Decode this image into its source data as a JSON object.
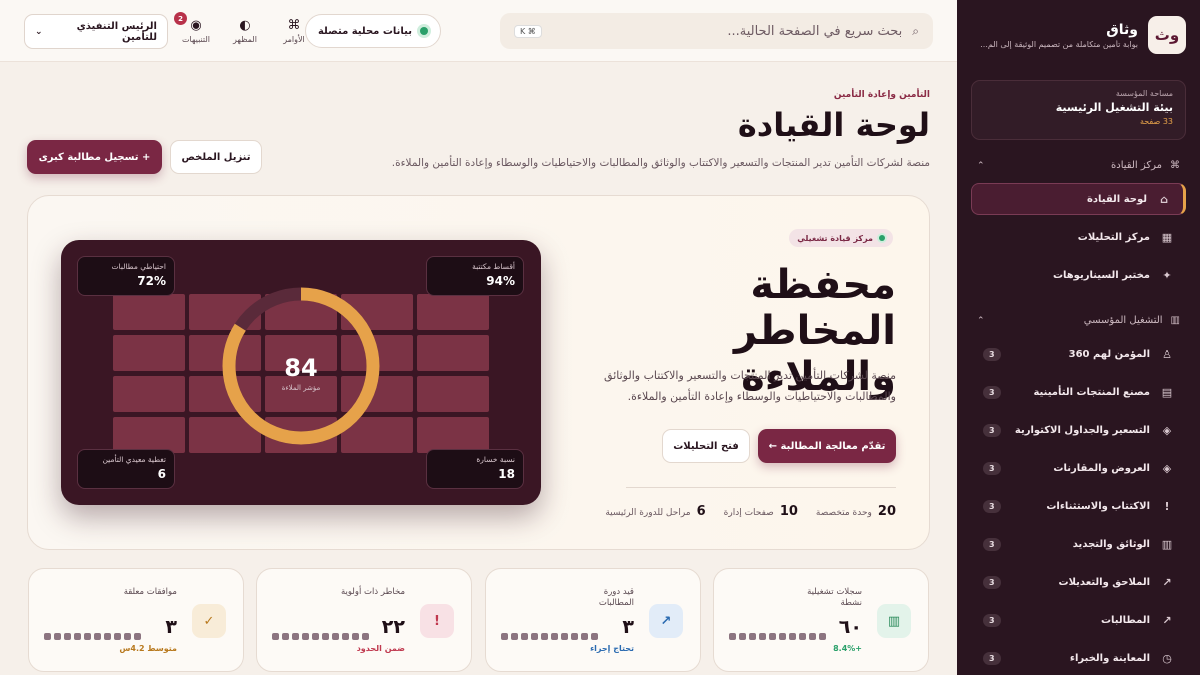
{
  "brand": {
    "logo": "وث",
    "name": "وثاق",
    "subtitle": "بوابة تأمين متكاملة من تصميم الوثيقة إلى الم..."
  },
  "workspace": {
    "label": "مساحة المؤسسة",
    "name": "بيئة التشغيل الرئيسية",
    "count": "33 صفحة"
  },
  "nav": {
    "section1": {
      "label": "مركز القيادة",
      "icon": "command-icon"
    },
    "items1": [
      {
        "label": "لوحة القيادة",
        "icon": "home-icon",
        "active": true
      },
      {
        "label": "مركز التحليلات",
        "icon": "chart-icon"
      },
      {
        "label": "مختبر السيناريوهات",
        "icon": "sparkle-icon"
      }
    ],
    "section2": {
      "label": "التشغيل المؤسسي",
      "icon": "building-icon"
    },
    "items2": [
      {
        "label": "المؤمن لهم 360",
        "icon": "user-icon",
        "badge": "3"
      },
      {
        "label": "مصنع المنتجات التأمينية",
        "icon": "factory-icon",
        "badge": "3"
      },
      {
        "label": "التسعير والجداول الاكتوارية",
        "icon": "diamond-icon",
        "badge": "3"
      },
      {
        "label": "العروض والمقارنات",
        "icon": "diamond-icon",
        "badge": "3"
      },
      {
        "label": "الاكتتاب والاستثناءات",
        "icon": "exclaim-icon",
        "badge": "3"
      },
      {
        "label": "الوثائق والتجديد",
        "icon": "document-icon",
        "badge": "3"
      },
      {
        "label": "الملاحق والتعديلات",
        "icon": "arrow-up-right-icon",
        "badge": "3"
      },
      {
        "label": "المطالبات",
        "icon": "arrow-up-right-icon",
        "badge": "3"
      },
      {
        "label": "المعاينة والخبراء",
        "icon": "eye-icon",
        "badge": "3"
      }
    ]
  },
  "topbar": {
    "search_placeholder": "بحث سريع في الصفحة الحالية...",
    "search_kbd": "⌘ K",
    "local_data": "بيانات محلية متصلة",
    "commands": "الأوامر",
    "appearance": "المظهر",
    "alerts": "التنبيهات",
    "alerts_count": "2",
    "user_role": "الرئيس التنفيذي للتأمين"
  },
  "header": {
    "eyebrow": "التأمين وإعادة التأمين",
    "title": "لوحة القيادة",
    "description": "منصة لشركات التأمين تدير المنتجات والتسعير والاكتتاب والوثائق والمطالبات والاحتياطيات والوسطاء وإعادة التأمين والملاءة.",
    "primary_button": "+ تسجيل مطالبة كبرى",
    "secondary_button": "تنزيل الملخص"
  },
  "hero": {
    "pill": "مركز قيادة تشغيلي",
    "title": "محفظة المخاطر والملاءة",
    "description": "منصة لشركات التأمين تدير المنتجات والتسعير والاكتتاب والوثائق والمطالبات والاحتياطيات والوسطاء وإعادة التأمين والملاءة.",
    "btn_primary": "تقدّم معالجة المطالبة ←",
    "btn_secondary": "فتح التحليلات",
    "stats": [
      {
        "value": "20",
        "label": "وحدة متخصصة"
      },
      {
        "value": "10",
        "label": "صفحات إدارة"
      },
      {
        "value": "6",
        "label": "مراحل للدورة الرئيسية"
      }
    ],
    "viz": {
      "gauge_value": "84",
      "gauge_label": "مؤشر الملاءة",
      "gauge_fraction": 0.84,
      "mini": [
        {
          "label": "أقساط مكتتبة",
          "value": "94%"
        },
        {
          "label": "احتياطي مطالبات",
          "value": "72%"
        },
        {
          "label": "نسبة خسارة",
          "value": "18"
        },
        {
          "label": "تغطية معيدي التأمين",
          "value": "6"
        }
      ]
    }
  },
  "cards": [
    {
      "label": "سجلات تشغيلية نشطة",
      "value": "٦٠",
      "sub": "+8.4%",
      "sub_color": "#2aa06a",
      "icon": "grid-icon",
      "icon_glyph": "▥",
      "icon_bg": "#e3f3ea",
      "icon_color": "#2a8a5a"
    },
    {
      "label": "قيد دورة المطالبات",
      "value": "٣",
      "sub": "تحتاج إجراء",
      "sub_color": "#2a6ab0",
      "icon": "arrow-up-right-icon",
      "icon_glyph": "↗",
      "icon_bg": "#e2ecf8",
      "icon_color": "#2a6ab0"
    },
    {
      "label": "مخاطر ذات أولوية",
      "value": "٢٢",
      "sub": "ضمن الحدود",
      "sub_color": "#c0394f",
      "icon": "exclaim-icon",
      "icon_glyph": "!",
      "icon_bg": "#f8e1e5",
      "icon_color": "#c0394f"
    },
    {
      "label": "موافقات معلقة",
      "value": "٣",
      "sub": "متوسط 4.2س",
      "sub_color": "#b8791e",
      "icon": "check-icon",
      "icon_glyph": "✓",
      "icon_bg": "#f8ecd8",
      "icon_color": "#b8791e"
    }
  ]
}
